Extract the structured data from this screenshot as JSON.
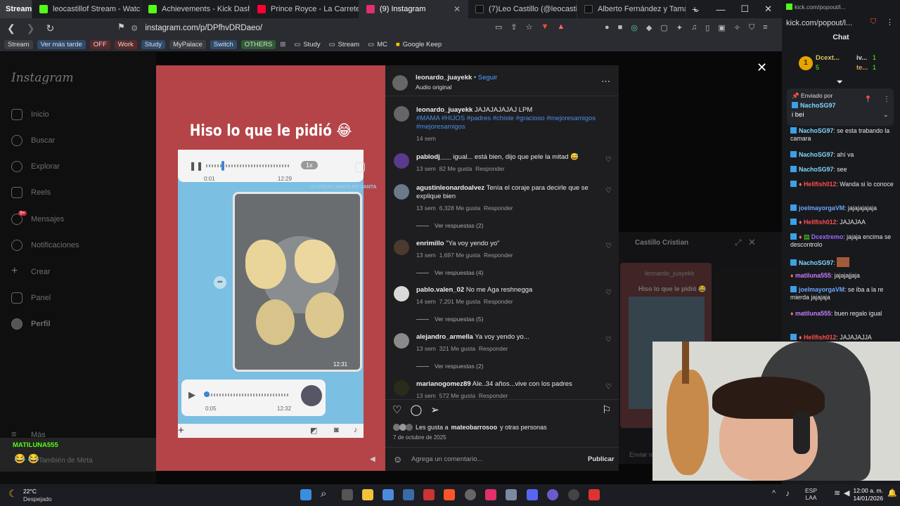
{
  "browser": {
    "tabs": [
      {
        "label": "Stream",
        "color": "#3a3b40"
      },
      {
        "label": "leocastillof Stream - Watch Live on",
        "color": "#53fc18"
      },
      {
        "label": "Achievements - Kick Dashboard",
        "color": "#53fc18"
      },
      {
        "label": "Prince Royce - La Carretera (Offici",
        "color": "#ff0033"
      },
      {
        "label": "(9) Instagram",
        "color": "#e1306c"
      },
      {
        "label": "(7)Leo Castillo (@leocastillo.f) | Tik",
        "color": "#111111"
      },
      {
        "label": "Alberto Fernández y Tamara Petti",
        "color": "#111111"
      }
    ],
    "url": "instagram.com/p/DPfhvDRDaeo/",
    "bookmarks": [
      "Stream",
      "Ver más tarde",
      "OFF",
      "Work",
      "Study",
      "MyPalace",
      "Switch",
      "OTHERS"
    ],
    "bookmark_folders": [
      "Study",
      "Stream",
      "MC",
      "Google Keep"
    ]
  },
  "instagram": {
    "logo": "Instagram",
    "nav": [
      "Inicio",
      "Buscar",
      "Explorar",
      "Reels",
      "Mensajes",
      "Notificaciones",
      "Crear",
      "Panel",
      "Perfil",
      "Más",
      "También de Meta"
    ],
    "messages_badge": "9+",
    "post_caption": "Hiso lo que le pidió 😂",
    "voice1": {
      "start": "0:01",
      "time": "12:29",
      "speed": "1x"
    },
    "photo_time": "12:31",
    "voice2": {
      "start": "0:05",
      "time": "12:32"
    },
    "watermark": "@LOBUSCAMOS EN SANTA",
    "author": "leonardo_juayekk",
    "follow": "Seguir",
    "audio": "Audio original",
    "caption_text": "JAJAJAJAJAJ LPM",
    "hashtags": "#MAMA #HIJOS #padres #chiste #gracioso #mejoresamigos #mejoresamigos",
    "caption_time": "14 sem",
    "comments": [
      {
        "user": "pablodj___",
        "text": "igual... está bien, dijo que pele la mitad 😅",
        "time": "13 sem",
        "likes": "82 Me gusta",
        "reply": "Responder",
        "view": ""
      },
      {
        "user": "agustinleonardoalvez",
        "text": "Tenía el coraje para decirle que se explique bien",
        "time": "13 sem",
        "likes": "6,328 Me gusta",
        "reply": "Responder",
        "view": "Ver respuestas (2)"
      },
      {
        "user": "enrimillo",
        "text": "\"Ya voy yendo yo\"",
        "time": "13 sem",
        "likes": "1,697 Me gusta",
        "reply": "Responder",
        "view": "Ver respuestas (4)"
      },
      {
        "user": "pablo.valen_02",
        "text": "No me Aga reshnegga",
        "time": "14 sem",
        "likes": "7,201 Me gusta",
        "reply": "Responder",
        "view": "Ver respuestas (5)"
      },
      {
        "user": "alejandro_armella",
        "text": "Ya voy yendo yo...",
        "time": "13 sem",
        "likes": "321 Me gusta",
        "reply": "Responder",
        "view": "Ver respuestas (2)"
      },
      {
        "user": "marianogomez89",
        "text": "Ale..34 años...vive con los padres",
        "time": "13 sem",
        "likes": "572 Me gusta",
        "reply": "Responder",
        "view": ""
      }
    ],
    "likes_line_prefix": "Les gusta a",
    "likes_user": "mateobarrosoo",
    "likes_suffix": "y otras personas",
    "date": "7 de octubre de 2025",
    "comment_placeholder": "Agrega un comentario...",
    "publish": "Publicar",
    "dim_chat_name": "Castillo Cristian",
    "dim_chat_user": "leonardo_juayekk",
    "dim_chat_caption": "Hiso lo que le pidió 😂",
    "dim_chat_input": "Enviar me",
    "overlay_user": "MATILUNA555",
    "overlay_emojis": "😂 😂"
  },
  "kick": {
    "url": "kick.com/popout/l...",
    "title": "Chat",
    "top_users": [
      {
        "name": "Dcext...",
        "count": "5"
      },
      {
        "name": "iv...",
        "count": "1"
      },
      {
        "name": "te...",
        "count": "1"
      }
    ],
    "pinned_label": "Enviado por",
    "pinned_user": "NachoSG97",
    "pinned_text": "i bei",
    "messages": [
      {
        "user": "NachoSG97",
        "color": "#7fd6ff",
        "text": "se esta trabando la camara"
      },
      {
        "user": "NachoSG97",
        "color": "#7fd6ff",
        "text": "ahí va"
      },
      {
        "user": "NachoSG97",
        "color": "#7fd6ff",
        "text": "see"
      },
      {
        "user": "Hellfish012",
        "color": "#ff4d4d",
        "text": "Wanda si lo conoce"
      },
      {
        "user": "joelmayorgaVM",
        "color": "#6aa7ff",
        "text": "jajajajajaja"
      },
      {
        "user": "Hellfish012",
        "color": "#ff4d4d",
        "text": "JAJAJAA"
      },
      {
        "user": "Dcextremo",
        "color": "#9b6bff",
        "text": "jajaja encima se descontrolo"
      },
      {
        "user": "NachoSG97",
        "color": "#7fd6ff",
        "text": ""
      },
      {
        "user": "matiluna555",
        "color": "#c77dff",
        "text": "jajajajjaja"
      },
      {
        "user": "joelmayorgaVM",
        "color": "#6aa7ff",
        "text": "se iba a la re mierda jajajaja"
      },
      {
        "user": "matiluna555",
        "color": "#c77dff",
        "text": "buen regalo igual"
      },
      {
        "user": "Hellfish012",
        "color": "#ff4d4d",
        "text": "JAJAJAJJA"
      }
    ]
  },
  "taskbar": {
    "temp": "22°C",
    "weather": "Despejado",
    "lang1": "ESP",
    "lang2": "LAA",
    "time": "12:00 a. m.",
    "date": "14/01/2026"
  }
}
